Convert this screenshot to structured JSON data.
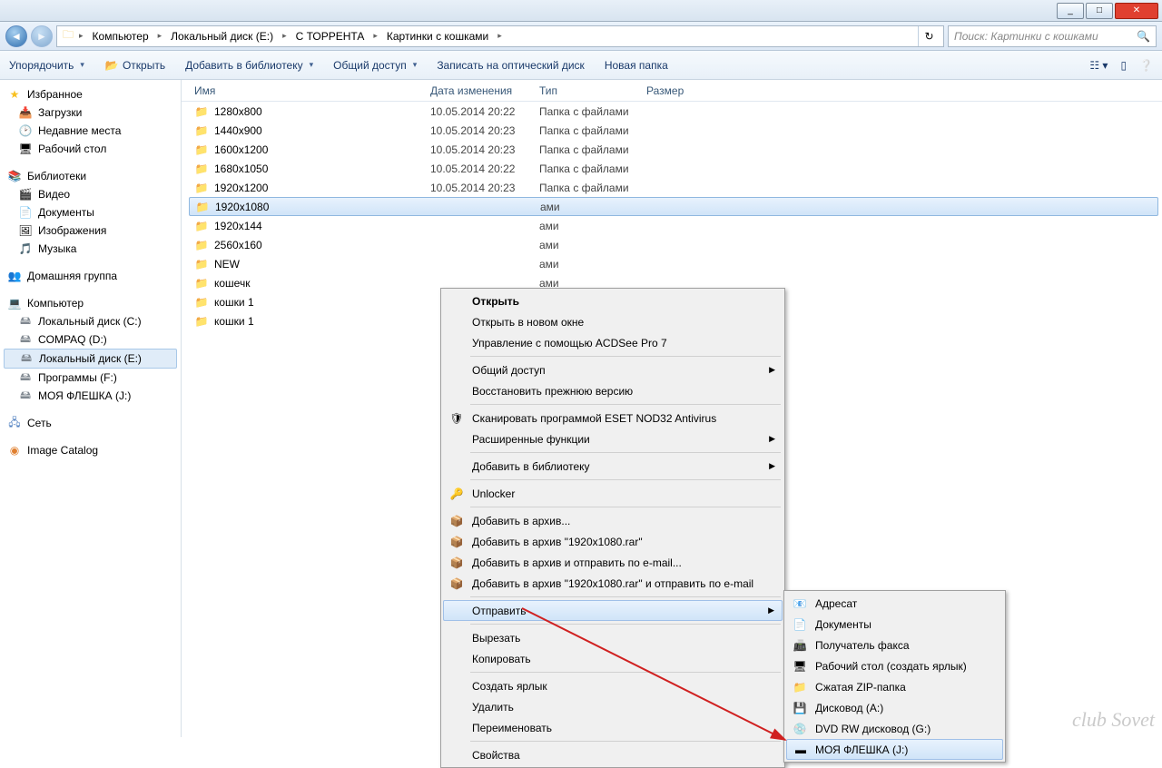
{
  "window": {
    "min": "_",
    "max": "□",
    "close": "✕"
  },
  "breadcrumb": {
    "items": [
      "Компьютер",
      "Локальный диск (E:)",
      "С ТОРРЕНТА",
      "Картинки с кошками"
    ]
  },
  "search": {
    "placeholder": "Поиск: Картинки с кошками"
  },
  "toolbar": {
    "organize": "Упорядочить",
    "open": "Открыть",
    "add_library": "Добавить в библиотеку",
    "share": "Общий доступ",
    "burn": "Записать на оптический диск",
    "new_folder": "Новая папка"
  },
  "sidebar": {
    "favorites": {
      "label": "Избранное",
      "items": [
        "Загрузки",
        "Недавние места",
        "Рабочий стол"
      ]
    },
    "libraries": {
      "label": "Библиотеки",
      "items": [
        "Видео",
        "Документы",
        "Изображения",
        "Музыка"
      ]
    },
    "homegroup": "Домашняя группа",
    "computer": {
      "label": "Компьютер",
      "items": [
        "Локальный диск (C:)",
        "COMPAQ (D:)",
        "Локальный диск (E:)",
        "Программы  (F:)",
        "МОЯ ФЛЕШКА (J:)"
      ]
    },
    "network": "Сеть",
    "catalog": "Image Catalog"
  },
  "columns": {
    "name": "Имя",
    "date": "Дата изменения",
    "type": "Тип",
    "size": "Размер"
  },
  "files": [
    {
      "name": "1280x800",
      "date": "10.05.2014 20:22",
      "type": "Папка с файлами"
    },
    {
      "name": "1440x900",
      "date": "10.05.2014 20:23",
      "type": "Папка с файлами"
    },
    {
      "name": "1600x1200",
      "date": "10.05.2014 20:23",
      "type": "Папка с файлами"
    },
    {
      "name": "1680x1050",
      "date": "10.05.2014 20:22",
      "type": "Папка с файлами"
    },
    {
      "name": "1920x1200",
      "date": "10.05.2014 20:23",
      "type": "Папка с файлами"
    },
    {
      "name": "1920x1080",
      "date": "",
      "type": "ами",
      "selected": true
    },
    {
      "name": "1920x144",
      "date": "",
      "type": "ами"
    },
    {
      "name": "2560x160",
      "date": "",
      "type": "ами"
    },
    {
      "name": "NEW",
      "date": "",
      "type": "ами"
    },
    {
      "name": "кошечк",
      "date": "",
      "type": "ами"
    },
    {
      "name": "кошки 1",
      "date": "",
      "type": "ами"
    },
    {
      "name": "кошки 1",
      "date": "",
      "type": "ами"
    }
  ],
  "context": {
    "items": [
      {
        "label": "Открыть",
        "bold": true
      },
      {
        "label": "Открыть в новом окне"
      },
      {
        "label": "Управление с помощью ACDSee Pro 7"
      },
      {
        "sep": true
      },
      {
        "label": "Общий доступ",
        "sub": true
      },
      {
        "label": "Восстановить прежнюю версию"
      },
      {
        "sep": true
      },
      {
        "label": "Сканировать программой ESET NOD32 Antivirus",
        "icon": "🛡"
      },
      {
        "label": "Расширенные функции",
        "sub": true
      },
      {
        "sep": true
      },
      {
        "label": "Добавить в библиотеку",
        "sub": true
      },
      {
        "sep": true
      },
      {
        "label": "Unlocker",
        "icon": "🔑"
      },
      {
        "sep": true
      },
      {
        "label": "Добавить в архив...",
        "icon": "📦"
      },
      {
        "label": "Добавить в архив \"1920x1080.rar\"",
        "icon": "📦"
      },
      {
        "label": "Добавить в архив и отправить по e-mail...",
        "icon": "📦"
      },
      {
        "label": "Добавить в архив \"1920x1080.rar\" и отправить по e-mail",
        "icon": "📦"
      },
      {
        "sep": true
      },
      {
        "label": "Отправить",
        "sub": true,
        "hl": true
      },
      {
        "sep": true
      },
      {
        "label": "Вырезать"
      },
      {
        "label": "Копировать"
      },
      {
        "sep": true
      },
      {
        "label": "Создать ярлык"
      },
      {
        "label": "Удалить"
      },
      {
        "label": "Переименовать"
      },
      {
        "sep": true
      },
      {
        "label": "Свойства"
      }
    ]
  },
  "submenu": {
    "items": [
      {
        "label": "Адресат",
        "icon": "📧"
      },
      {
        "label": "Документы",
        "icon": "📄"
      },
      {
        "label": "Получатель факса",
        "icon": "📠"
      },
      {
        "label": "Рабочий стол (создать ярлык)",
        "icon": "🖥"
      },
      {
        "label": "Сжатая ZIP-папка",
        "icon": "📁"
      },
      {
        "label": "Дисковод (A:)",
        "icon": "💾"
      },
      {
        "label": "DVD RW дисковод (G:)",
        "icon": "💿"
      },
      {
        "label": "МОЯ ФЛЕШКА (J:)",
        "icon": "▬",
        "hl": true
      }
    ]
  },
  "watermark": "club Sovet"
}
